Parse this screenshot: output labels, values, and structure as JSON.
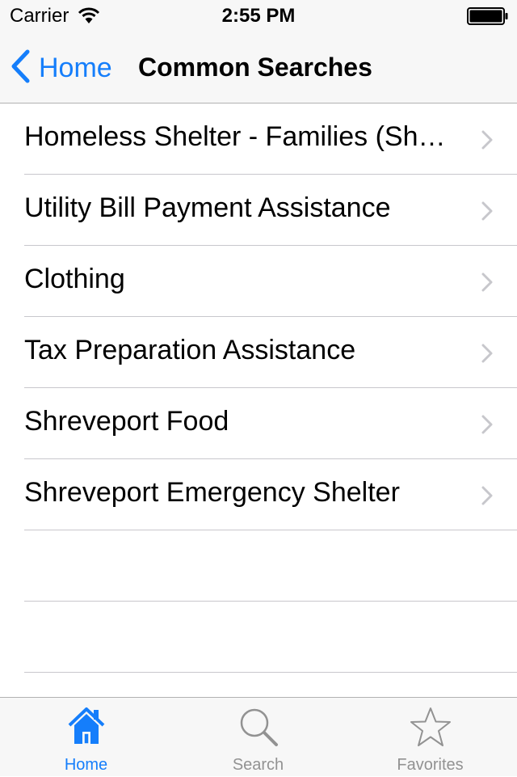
{
  "status_bar": {
    "carrier": "Carrier",
    "time": "2:55 PM"
  },
  "nav": {
    "back_label": "Home",
    "title": "Common Searches"
  },
  "list": {
    "items": [
      {
        "label": "Homeless Shelter - Families (Shreveport)"
      },
      {
        "label": "Utility Bill Payment Assistance"
      },
      {
        "label": "Clothing"
      },
      {
        "label": "Tax Preparation Assistance"
      },
      {
        "label": "Shreveport Food"
      },
      {
        "label": "Shreveport Emergency Shelter"
      }
    ]
  },
  "tabbar": {
    "tabs": [
      {
        "label": "Home",
        "icon": "house-icon",
        "selected": true
      },
      {
        "label": "Search",
        "icon": "magnifier-icon",
        "selected": false
      },
      {
        "label": "Favorites",
        "icon": "star-icon",
        "selected": false
      }
    ]
  },
  "colors": {
    "accent": "#157efb",
    "inactive": "#929292",
    "chevron": "#c7c7cc",
    "separator": "#c8c7cc"
  }
}
